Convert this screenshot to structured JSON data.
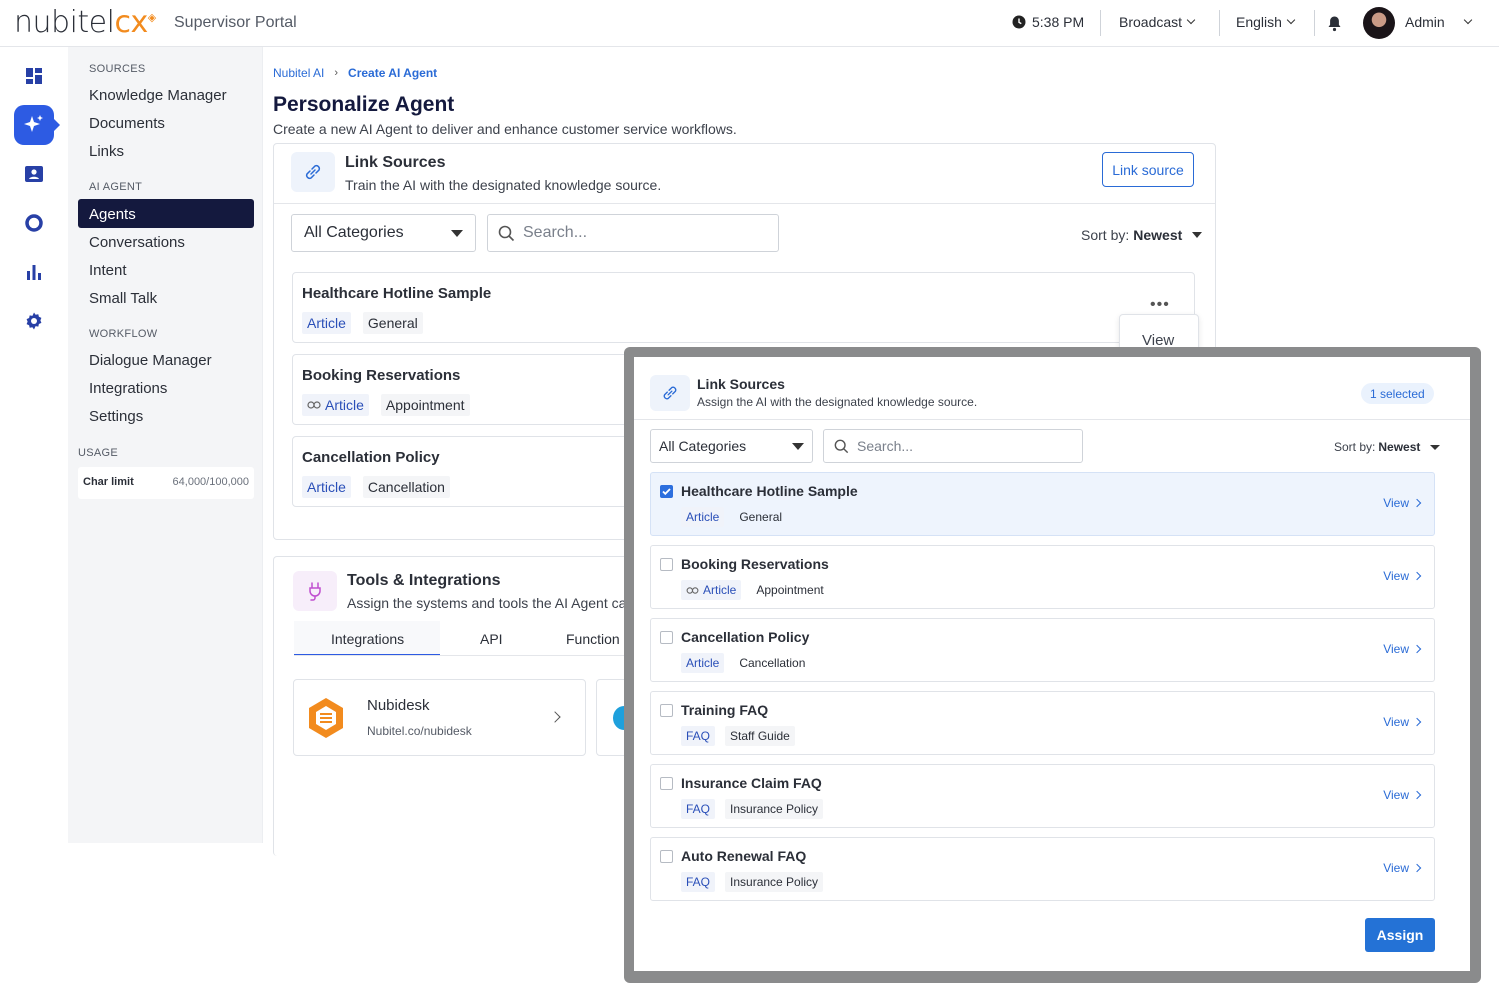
{
  "header": {
    "logo_main": "nubitel",
    "logo_cx": "cx",
    "portal_title": "Supervisor Portal",
    "time": "5:38 PM",
    "broadcast": "Broadcast",
    "language": "English",
    "user": "Admin"
  },
  "rail": {
    "items": [
      "dashboard-icon",
      "ai-sparkle-icon",
      "contact-card-icon",
      "circle-icon",
      "bar-chart-icon",
      "gear-icon"
    ],
    "active": "ai-sparkle-icon",
    "accent": "#2d5be3"
  },
  "nav": {
    "sources_heading": "SOURCES",
    "sources": [
      "Knowledge Manager",
      "Documents",
      "Links"
    ],
    "ai_agent_heading": "AI AGENT",
    "ai_agent": [
      "Agents",
      "Conversations",
      "Intent",
      "Small Talk"
    ],
    "workflow_heading": "WORKFLOW",
    "workflow": [
      "Dialogue Manager",
      "Integrations",
      "Settings"
    ],
    "usage_heading": "USAGE",
    "char_limit_label": "Char limit",
    "char_limit_value": "64,000/100,000"
  },
  "breadcrumb": [
    "Nubitel AI",
    "Create AI Agent"
  ],
  "page": {
    "title": "Personalize Agent",
    "subtitle": "Create a new AI Agent to deliver and enhance customer service workflows."
  },
  "link_sources": {
    "title": "Link Sources",
    "subtitle": "Train the AI with the designated knowledge source.",
    "button": "Link source",
    "category_select": "All Categories",
    "search_placeholder": "Search...",
    "sort_label": "Sort by:",
    "sort_value": "Newest",
    "items": [
      {
        "title": "Healthcare Hotline Sample",
        "type": "Article",
        "category": "General"
      },
      {
        "title": "Booking Reservations",
        "type": "Article",
        "category": "Appointment"
      },
      {
        "title": "Cancellation Policy",
        "type": "Article",
        "category": "Cancellation"
      }
    ],
    "menu_view": "View"
  },
  "tools": {
    "title": "Tools & Integrations",
    "subtitle": "Assign the systems and tools the AI Agent can",
    "tabs": [
      "Integrations",
      "API",
      "Function"
    ],
    "integration": {
      "name": "Nubidesk",
      "url": "Nubitel.co/nubidesk"
    },
    "accent": "#f28b1e"
  },
  "modal": {
    "title": "Link Sources",
    "subtitle": "Assign the AI with the designated knowledge source.",
    "selected_badge": "1 selected",
    "category_select": "All Categories",
    "search_placeholder": "Search...",
    "sort_label": "Sort by:",
    "sort_value": "Newest",
    "view_label": "View",
    "assign_button": "Assign",
    "items": [
      {
        "title": "Healthcare Hotline Sample",
        "type": "Article",
        "category": "General",
        "checked": true
      },
      {
        "title": "Booking Reservations",
        "type": "Article",
        "category": "Appointment",
        "checked": false
      },
      {
        "title": "Cancellation Policy",
        "type": "Article",
        "category": "Cancellation",
        "checked": false
      },
      {
        "title": "Training FAQ",
        "type": "FAQ",
        "category": "Staff Guide",
        "checked": false
      },
      {
        "title": "Insurance Claim FAQ",
        "type": "FAQ",
        "category": "Insurance Policy",
        "checked": false
      },
      {
        "title": "Auto Renewal FAQ",
        "type": "FAQ",
        "category": "Insurance Policy",
        "checked": false
      }
    ],
    "primary_color": "#2472d6"
  }
}
